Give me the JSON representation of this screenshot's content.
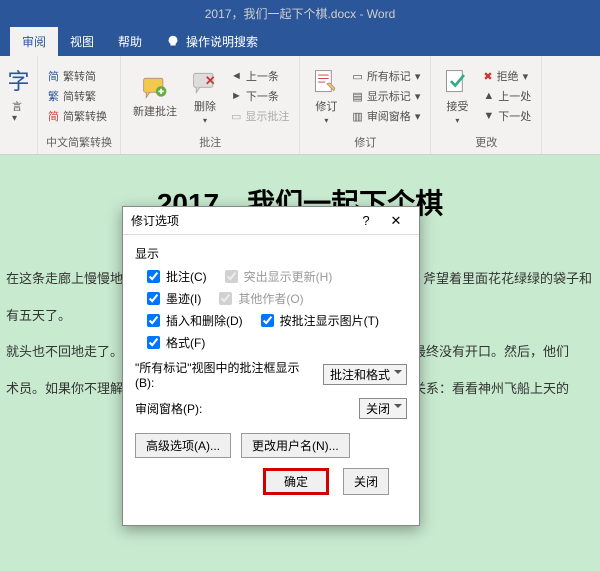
{
  "title": "2017，我们一起下个棋.docx  -  Word",
  "tabs": {
    "review": "审阅",
    "view": "视图",
    "help": "帮助",
    "search": "操作说明搜索"
  },
  "ribbon": {
    "grp1": {
      "label": "中文简繁转换",
      "a": "繁转简",
      "b": "简转繁",
      "c": "简繁转换"
    },
    "grp2": {
      "label": "批注",
      "new": "新建批注",
      "del": "删除",
      "prev": "上一条",
      "next": "下一条",
      "show": "显示批注"
    },
    "grp3": {
      "label": "修订",
      "track": "修订",
      "allmk": "所有标记",
      "showmk": "显示标记",
      "pane": "审阅窗格"
    },
    "grp4": {
      "label": "更改",
      "accept": "接受",
      "reject": "拒绝",
      "prev": "上一处",
      "next": "下一处"
    }
  },
  "doc": {
    "title": "2017，我们一起下个棋",
    "p1": "在这条走廊上慢慢地",
    "p1b": "斧望着里面花花绿绿的袋子和",
    "p2": "有五天了。",
    "p3": "就头也不回地走了。",
    "p3b": "最终没有开口。然后，他们",
    "p4": "术员。如果你不理解",
    "p4b": "关系：看看神州飞船上天的"
  },
  "dialog": {
    "title": "修订选项",
    "section": "显示",
    "chk": {
      "c": "批注(C)",
      "i": "墨迹(I)",
      "d": "插入和删除(D)",
      "f": "格式(F)",
      "h": "突出显示更新(H)",
      "o": "其他作者(O)",
      "t": "按批注显示图片(T)"
    },
    "lbl1": "\"所有标记\"视图中的批注框显示(B):",
    "sel1": "批注和格式",
    "lbl2": "审阅窗格(P):",
    "sel2": "关闭",
    "adv": "高级选项(A)...",
    "user": "更改用户名(N)...",
    "ok": "确定",
    "cancel": "关闭"
  }
}
